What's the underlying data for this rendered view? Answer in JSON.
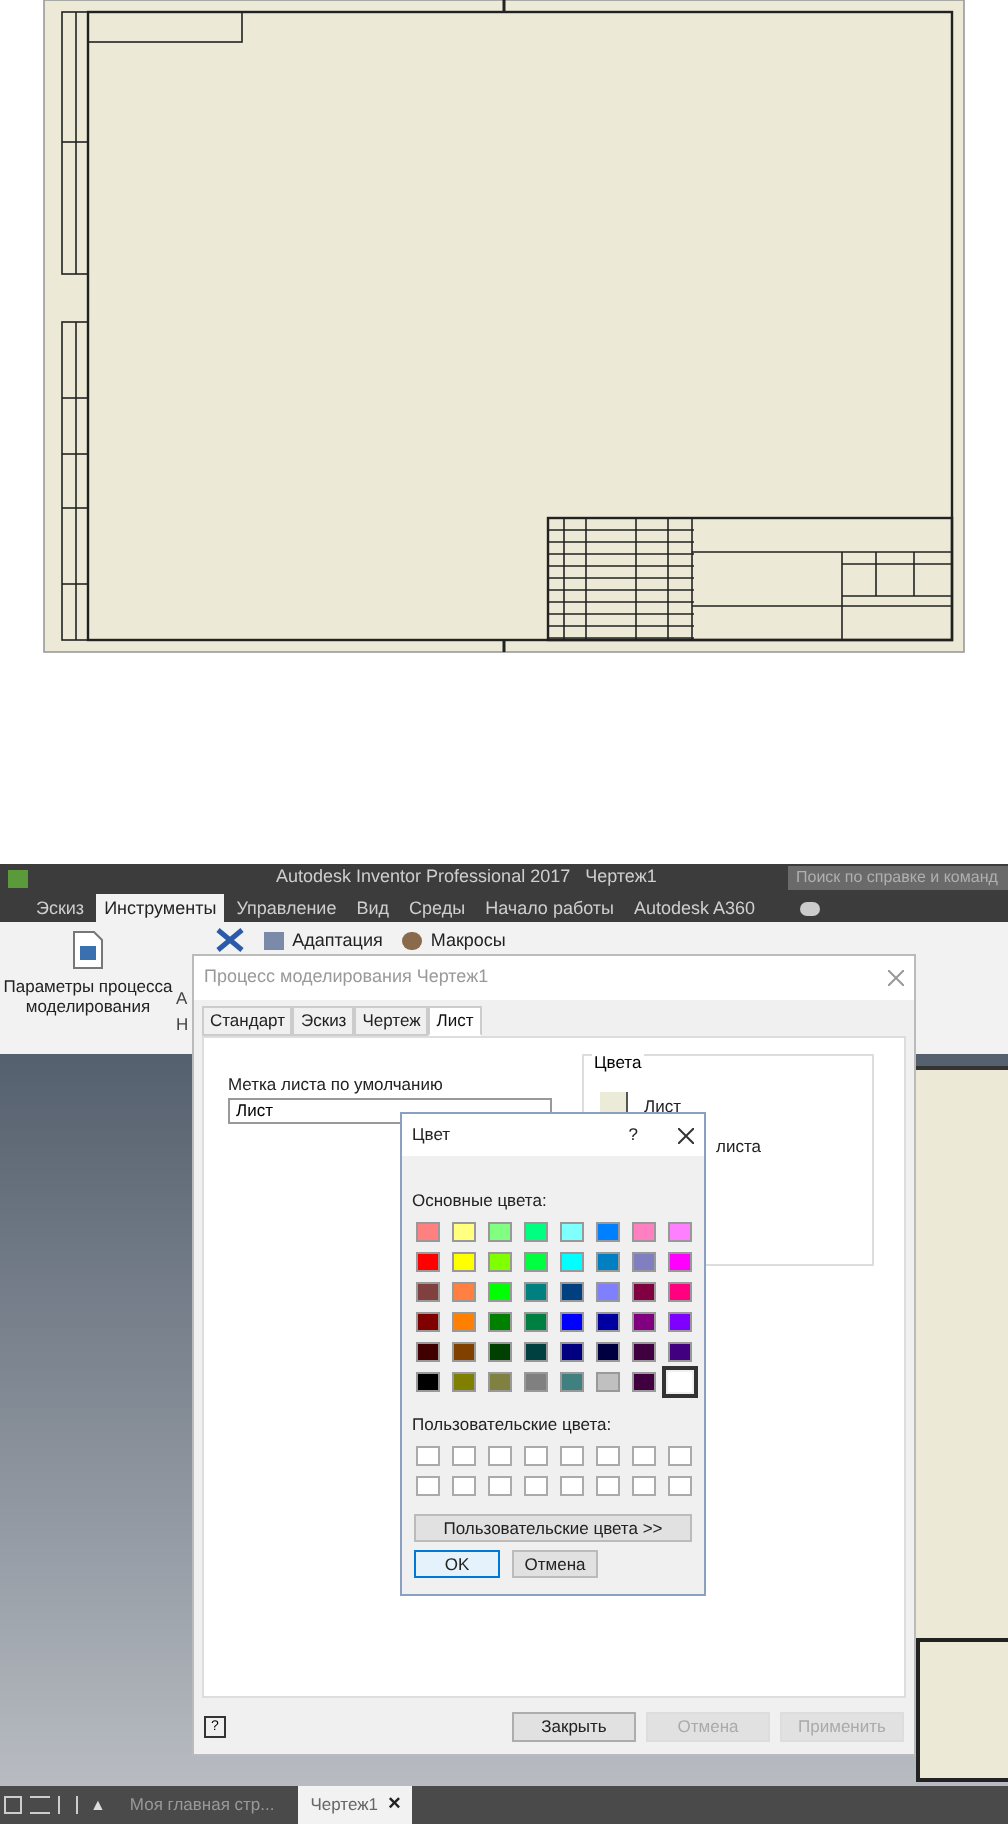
{
  "app": {
    "title": "Autodesk Inventor Professional 2017   Чертеж1",
    "search": {
      "placeholder": "Поиск по справке и команд"
    }
  },
  "ribbon_tabs": [
    {
      "label": "Эскиз",
      "selected": false
    },
    {
      "label": "Инструменты",
      "selected": true
    },
    {
      "label": "Управление",
      "selected": false
    },
    {
      "label": "Вид",
      "selected": false
    },
    {
      "label": "Среды",
      "selected": false
    },
    {
      "label": "Начало работы",
      "selected": false
    },
    {
      "label": "Autodesk A360",
      "selected": false
    }
  ],
  "ribbon": {
    "big_button": "Параметры процесса моделирования",
    "small_buttons": [
      "Адаптация",
      "Макросы"
    ],
    "cut_labels": [
      "А",
      "Н"
    ]
  },
  "dialog": {
    "title": "Процесс моделирования Чертеж1",
    "tabs": [
      {
        "label": "Стандарт",
        "selected": false
      },
      {
        "label": "Эскиз",
        "selected": false
      },
      {
        "label": "Чертеж",
        "selected": false
      },
      {
        "label": "Лист",
        "selected": true
      }
    ],
    "help": "?",
    "field_label": "Метка листа по умолчанию",
    "field_value": "Лист",
    "colors_group": {
      "title": "Цвета",
      "items": [
        {
          "label": "Лист",
          "color": "#ecebd8"
        },
        {
          "label": "листа"
        }
      ]
    },
    "buttons": [
      {
        "label": "Закрыть",
        "disabled": false
      },
      {
        "label": "Отмена",
        "disabled": true
      },
      {
        "label": "Применить",
        "disabled": true
      }
    ]
  },
  "color_dialog": {
    "title": "Цвет",
    "help": "?",
    "basic_label": "Основные цвета:",
    "basic_colors": [
      {
        "color": "#ff8080",
        "selected": false
      },
      {
        "color": "#ffff80",
        "selected": false
      },
      {
        "color": "#80ff80",
        "selected": false
      },
      {
        "color": "#00ff80",
        "selected": false
      },
      {
        "color": "#80ffff",
        "selected": false
      },
      {
        "color": "#0080ff",
        "selected": false
      },
      {
        "color": "#ff80c0",
        "selected": false
      },
      {
        "color": "#ff80ff",
        "selected": false
      },
      {
        "color": "#ff0000",
        "selected": false
      },
      {
        "color": "#ffff00",
        "selected": false
      },
      {
        "color": "#80ff00",
        "selected": false
      },
      {
        "color": "#00ff40",
        "selected": false
      },
      {
        "color": "#00ffff",
        "selected": false
      },
      {
        "color": "#0080c0",
        "selected": false
      },
      {
        "color": "#8080c0",
        "selected": false
      },
      {
        "color": "#ff00ff",
        "selected": false
      },
      {
        "color": "#804040",
        "selected": false
      },
      {
        "color": "#ff8040",
        "selected": false
      },
      {
        "color": "#00ff00",
        "selected": false
      },
      {
        "color": "#008080",
        "selected": false
      },
      {
        "color": "#004080",
        "selected": false
      },
      {
        "color": "#8080ff",
        "selected": false
      },
      {
        "color": "#800040",
        "selected": false
      },
      {
        "color": "#ff0080",
        "selected": false
      },
      {
        "color": "#800000",
        "selected": false
      },
      {
        "color": "#ff8000",
        "selected": false
      },
      {
        "color": "#008000",
        "selected": false
      },
      {
        "color": "#008040",
        "selected": false
      },
      {
        "color": "#0000ff",
        "selected": false
      },
      {
        "color": "#0000a0",
        "selected": false
      },
      {
        "color": "#800080",
        "selected": false
      },
      {
        "color": "#8000ff",
        "selected": false
      },
      {
        "color": "#400000",
        "selected": false
      },
      {
        "color": "#804000",
        "selected": false
      },
      {
        "color": "#004000",
        "selected": false
      },
      {
        "color": "#004040",
        "selected": false
      },
      {
        "color": "#000080",
        "selected": false
      },
      {
        "color": "#000040",
        "selected": false
      },
      {
        "color": "#400040",
        "selected": false
      },
      {
        "color": "#400080",
        "selected": false
      },
      {
        "color": "#000000",
        "selected": false
      },
      {
        "color": "#808000",
        "selected": false
      },
      {
        "color": "#808040",
        "selected": false
      },
      {
        "color": "#808080",
        "selected": false
      },
      {
        "color": "#408080",
        "selected": false
      },
      {
        "color": "#c0c0c0",
        "selected": false
      },
      {
        "color": "#400040",
        "selected": false
      },
      {
        "color": "#ffffff",
        "selected": true
      }
    ],
    "custom_label": "Пользовательские цвета:",
    "custom_colors": [
      {
        "color": "#ffffff"
      },
      {
        "color": "#ffffff"
      },
      {
        "color": "#ffffff"
      },
      {
        "color": "#ffffff"
      },
      {
        "color": "#ffffff"
      },
      {
        "color": "#ffffff"
      },
      {
        "color": "#ffffff"
      },
      {
        "color": "#ffffff"
      },
      {
        "color": "#ffffff"
      },
      {
        "color": "#ffffff"
      },
      {
        "color": "#ffffff"
      },
      {
        "color": "#ffffff"
      },
      {
        "color": "#ffffff"
      },
      {
        "color": "#ffffff"
      },
      {
        "color": "#ffffff"
      },
      {
        "color": "#ffffff"
      }
    ],
    "define_button": "Пользовательские цвета >>",
    "ok": "OK",
    "cancel": "Отмена"
  },
  "status_bar": {
    "up": "▲",
    "doc_tabs": [
      {
        "label": "Моя главная стр...",
        "selected": false,
        "closable": false
      },
      {
        "label": "Чертеж1",
        "selected": true,
        "closable": true
      }
    ],
    "close": "×"
  }
}
